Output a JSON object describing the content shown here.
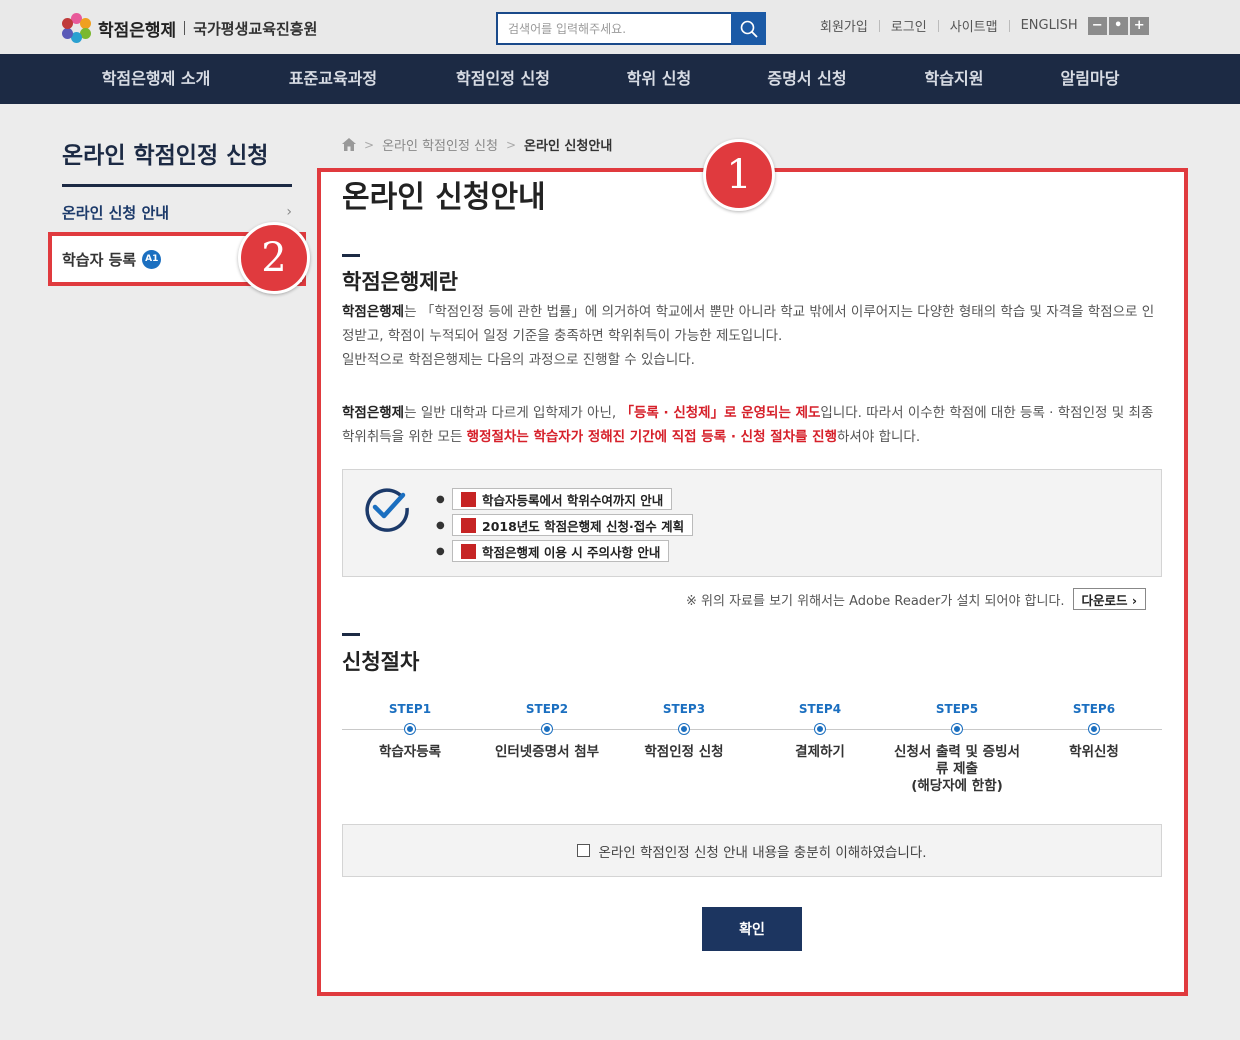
{
  "header": {
    "logo_main": "학점은행제",
    "logo_sub": "국가평생교육진흥원",
    "search_placeholder": "검색어를 입력해주세요.",
    "util_links": [
      "회원가입",
      "로그인",
      "사이트맵",
      "ENGLISH"
    ],
    "zoom": [
      "−",
      "•",
      "+"
    ]
  },
  "gnb": [
    "학점은행제 소개",
    "표준교육과정",
    "학점인정 신청",
    "학위 신청",
    "증명서 신청",
    "학습지원",
    "알림마당"
  ],
  "sidebar": {
    "title": "온라인 학점인정 신청",
    "items": [
      {
        "label": "온라인 신청 안내",
        "chevron": "›"
      },
      {
        "label": "학습자 등록",
        "badge": "A1"
      }
    ]
  },
  "annotations": [
    "1",
    "2"
  ],
  "breadcrumb": [
    "온라인 학점인정 신청",
    "온라인 신청안내"
  ],
  "main": {
    "page_title": "온라인 신청안내",
    "section1_title": "학점은행제란",
    "p1_bold": "학점은행제",
    "p1_text": "는 「학점인정 등에 관한 법률」에 의거하여 학교에서 뿐만 아니라 학교 밖에서 이루어지는 다양한 형태의 학습 및 자격을 학점으로 인정받고, 학점이 누적되어 일정 기준을 충족하면 학위취득이 가능한 제도입니다.",
    "p1_text2": "일반적으로 학점은행제는 다음의 과정으로 진행할 수 있습니다.",
    "p2_bold": "학점은행제",
    "p2_text_a": "는 일반 대학과 다르게 입학제가 아닌, ",
    "p2_red1": "「등록 · 신청제」로 운영되는 제도",
    "p2_text_b": "입니다. 따라서 이수한 학점에 대한 등록 · 학점인정 및 최종 학위취득을 위한 모든 ",
    "p2_red2": "행정절차는 학습자가 정해진 기간에 직접 등록 · 신청 절차를 진행",
    "p2_text_c": "하셔야 합니다.",
    "docs": [
      "학습자등록에서 학위수여까지 안내",
      "2018년도 학점은행제 신청·접수 계획",
      "학점은행제 이용 시 주의사항 안내"
    ],
    "adobe_note": "※ 위의 자료를 보기 위해서는 Adobe Reader가 설치 되어야 합니다.",
    "download_label": "다운로드 ›",
    "section2_title": "신청절차",
    "steps": [
      {
        "label": "STEP1",
        "name": "학습자등록"
      },
      {
        "label": "STEP2",
        "name": "인터넷증명서 첨부"
      },
      {
        "label": "STEP3",
        "name": "학점인정 신청"
      },
      {
        "label": "STEP4",
        "name": "결제하기"
      },
      {
        "label": "STEP5",
        "name": "신청서 출력 및 증빙서류 제출",
        "name2": "(해당자에 한함)"
      },
      {
        "label": "STEP6",
        "name": "학위신청"
      }
    ],
    "agree_text": "온라인 학점인정 신청 안내 내용을 충분히 이해하였습니다.",
    "confirm_label": "확인"
  },
  "colors": {
    "nav": "#1c2a44",
    "accent_blue": "#1b6fc0",
    "highlight_red": "#e03a3e",
    "text_red": "#d6202a"
  }
}
